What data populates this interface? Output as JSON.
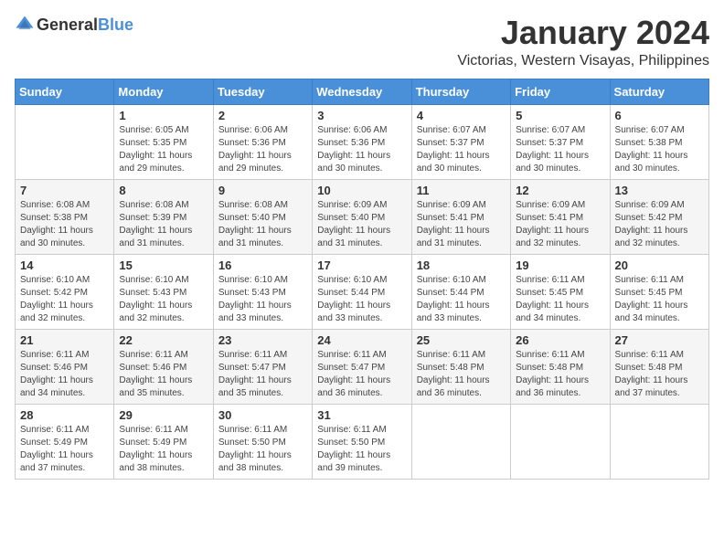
{
  "header": {
    "logo_general": "General",
    "logo_blue": "Blue",
    "month_title": "January 2024",
    "subtitle": "Victorias, Western Visayas, Philippines"
  },
  "weekdays": [
    "Sunday",
    "Monday",
    "Tuesday",
    "Wednesday",
    "Thursday",
    "Friday",
    "Saturday"
  ],
  "weeks": [
    [
      {
        "day": "",
        "sunrise": "",
        "sunset": "",
        "daylight": ""
      },
      {
        "day": "1",
        "sunrise": "Sunrise: 6:05 AM",
        "sunset": "Sunset: 5:35 PM",
        "daylight": "Daylight: 11 hours and 29 minutes."
      },
      {
        "day": "2",
        "sunrise": "Sunrise: 6:06 AM",
        "sunset": "Sunset: 5:36 PM",
        "daylight": "Daylight: 11 hours and 29 minutes."
      },
      {
        "day": "3",
        "sunrise": "Sunrise: 6:06 AM",
        "sunset": "Sunset: 5:36 PM",
        "daylight": "Daylight: 11 hours and 30 minutes."
      },
      {
        "day": "4",
        "sunrise": "Sunrise: 6:07 AM",
        "sunset": "Sunset: 5:37 PM",
        "daylight": "Daylight: 11 hours and 30 minutes."
      },
      {
        "day": "5",
        "sunrise": "Sunrise: 6:07 AM",
        "sunset": "Sunset: 5:37 PM",
        "daylight": "Daylight: 11 hours and 30 minutes."
      },
      {
        "day": "6",
        "sunrise": "Sunrise: 6:07 AM",
        "sunset": "Sunset: 5:38 PM",
        "daylight": "Daylight: 11 hours and 30 minutes."
      }
    ],
    [
      {
        "day": "7",
        "sunrise": "Sunrise: 6:08 AM",
        "sunset": "Sunset: 5:38 PM",
        "daylight": "Daylight: 11 hours and 30 minutes."
      },
      {
        "day": "8",
        "sunrise": "Sunrise: 6:08 AM",
        "sunset": "Sunset: 5:39 PM",
        "daylight": "Daylight: 11 hours and 31 minutes."
      },
      {
        "day": "9",
        "sunrise": "Sunrise: 6:08 AM",
        "sunset": "Sunset: 5:40 PM",
        "daylight": "Daylight: 11 hours and 31 minutes."
      },
      {
        "day": "10",
        "sunrise": "Sunrise: 6:09 AM",
        "sunset": "Sunset: 5:40 PM",
        "daylight": "Daylight: 11 hours and 31 minutes."
      },
      {
        "day": "11",
        "sunrise": "Sunrise: 6:09 AM",
        "sunset": "Sunset: 5:41 PM",
        "daylight": "Daylight: 11 hours and 31 minutes."
      },
      {
        "day": "12",
        "sunrise": "Sunrise: 6:09 AM",
        "sunset": "Sunset: 5:41 PM",
        "daylight": "Daylight: 11 hours and 32 minutes."
      },
      {
        "day": "13",
        "sunrise": "Sunrise: 6:09 AM",
        "sunset": "Sunset: 5:42 PM",
        "daylight": "Daylight: 11 hours and 32 minutes."
      }
    ],
    [
      {
        "day": "14",
        "sunrise": "Sunrise: 6:10 AM",
        "sunset": "Sunset: 5:42 PM",
        "daylight": "Daylight: 11 hours and 32 minutes."
      },
      {
        "day": "15",
        "sunrise": "Sunrise: 6:10 AM",
        "sunset": "Sunset: 5:43 PM",
        "daylight": "Daylight: 11 hours and 32 minutes."
      },
      {
        "day": "16",
        "sunrise": "Sunrise: 6:10 AM",
        "sunset": "Sunset: 5:43 PM",
        "daylight": "Daylight: 11 hours and 33 minutes."
      },
      {
        "day": "17",
        "sunrise": "Sunrise: 6:10 AM",
        "sunset": "Sunset: 5:44 PM",
        "daylight": "Daylight: 11 hours and 33 minutes."
      },
      {
        "day": "18",
        "sunrise": "Sunrise: 6:10 AM",
        "sunset": "Sunset: 5:44 PM",
        "daylight": "Daylight: 11 hours and 33 minutes."
      },
      {
        "day": "19",
        "sunrise": "Sunrise: 6:11 AM",
        "sunset": "Sunset: 5:45 PM",
        "daylight": "Daylight: 11 hours and 34 minutes."
      },
      {
        "day": "20",
        "sunrise": "Sunrise: 6:11 AM",
        "sunset": "Sunset: 5:45 PM",
        "daylight": "Daylight: 11 hours and 34 minutes."
      }
    ],
    [
      {
        "day": "21",
        "sunrise": "Sunrise: 6:11 AM",
        "sunset": "Sunset: 5:46 PM",
        "daylight": "Daylight: 11 hours and 34 minutes."
      },
      {
        "day": "22",
        "sunrise": "Sunrise: 6:11 AM",
        "sunset": "Sunset: 5:46 PM",
        "daylight": "Daylight: 11 hours and 35 minutes."
      },
      {
        "day": "23",
        "sunrise": "Sunrise: 6:11 AM",
        "sunset": "Sunset: 5:47 PM",
        "daylight": "Daylight: 11 hours and 35 minutes."
      },
      {
        "day": "24",
        "sunrise": "Sunrise: 6:11 AM",
        "sunset": "Sunset: 5:47 PM",
        "daylight": "Daylight: 11 hours and 36 minutes."
      },
      {
        "day": "25",
        "sunrise": "Sunrise: 6:11 AM",
        "sunset": "Sunset: 5:48 PM",
        "daylight": "Daylight: 11 hours and 36 minutes."
      },
      {
        "day": "26",
        "sunrise": "Sunrise: 6:11 AM",
        "sunset": "Sunset: 5:48 PM",
        "daylight": "Daylight: 11 hours and 36 minutes."
      },
      {
        "day": "27",
        "sunrise": "Sunrise: 6:11 AM",
        "sunset": "Sunset: 5:48 PM",
        "daylight": "Daylight: 11 hours and 37 minutes."
      }
    ],
    [
      {
        "day": "28",
        "sunrise": "Sunrise: 6:11 AM",
        "sunset": "Sunset: 5:49 PM",
        "daylight": "Daylight: 11 hours and 37 minutes."
      },
      {
        "day": "29",
        "sunrise": "Sunrise: 6:11 AM",
        "sunset": "Sunset: 5:49 PM",
        "daylight": "Daylight: 11 hours and 38 minutes."
      },
      {
        "day": "30",
        "sunrise": "Sunrise: 6:11 AM",
        "sunset": "Sunset: 5:50 PM",
        "daylight": "Daylight: 11 hours and 38 minutes."
      },
      {
        "day": "31",
        "sunrise": "Sunrise: 6:11 AM",
        "sunset": "Sunset: 5:50 PM",
        "daylight": "Daylight: 11 hours and 39 minutes."
      },
      {
        "day": "",
        "sunrise": "",
        "sunset": "",
        "daylight": ""
      },
      {
        "day": "",
        "sunrise": "",
        "sunset": "",
        "daylight": ""
      },
      {
        "day": "",
        "sunrise": "",
        "sunset": "",
        "daylight": ""
      }
    ]
  ]
}
